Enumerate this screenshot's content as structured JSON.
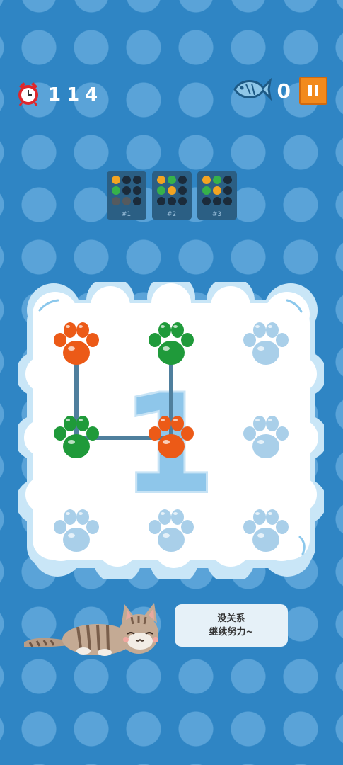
{
  "hud": {
    "timer_icon": "alarm-clock-icon",
    "timer_value": "114",
    "fish_icon": "fish-icon",
    "fish_count": "0",
    "pause_icon": "pause-icon"
  },
  "patterns": [
    {
      "label": "#1",
      "dots": [
        "orange",
        "dark",
        "dark",
        "green",
        "dark",
        "dark",
        "gray",
        "gray",
        "dark"
      ]
    },
    {
      "label": "#2",
      "dots": [
        "orange",
        "green",
        "dark",
        "green",
        "orange",
        "dark",
        "dark",
        "dark",
        "dark"
      ]
    },
    {
      "label": "#3",
      "dots": [
        "orange",
        "green",
        "dark",
        "green",
        "orange",
        "dark",
        "dark",
        "dark",
        "dark"
      ]
    }
  ],
  "board": {
    "hint_number": "1",
    "paws": [
      {
        "row": 0,
        "col": 0,
        "color": "orange"
      },
      {
        "row": 0,
        "col": 1,
        "color": "green"
      },
      {
        "row": 0,
        "col": 2,
        "color": "empty"
      },
      {
        "row": 1,
        "col": 0,
        "color": "green"
      },
      {
        "row": 1,
        "col": 1,
        "color": "orange"
      },
      {
        "row": 1,
        "col": 2,
        "color": "empty"
      },
      {
        "row": 2,
        "col": 0,
        "color": "empty"
      },
      {
        "row": 2,
        "col": 1,
        "color": "empty"
      },
      {
        "row": 2,
        "col": 2,
        "color": "empty"
      }
    ],
    "path": [
      [
        0,
        0
      ],
      [
        1,
        0
      ],
      [
        1,
        1
      ],
      [
        0,
        1
      ]
    ]
  },
  "message": {
    "line1": "没关系",
    "line2": "继续努力~"
  },
  "colors": {
    "orange": "#ec5a17",
    "green": "#1f9a3a",
    "empty": "#a9cfe9",
    "dark": "#1b2b3a",
    "gray": "#555a5e",
    "pattern_orange": "#f2a422",
    "pattern_green": "#36b24a",
    "line": "#4f7f9d",
    "background": "#2f85c4"
  }
}
